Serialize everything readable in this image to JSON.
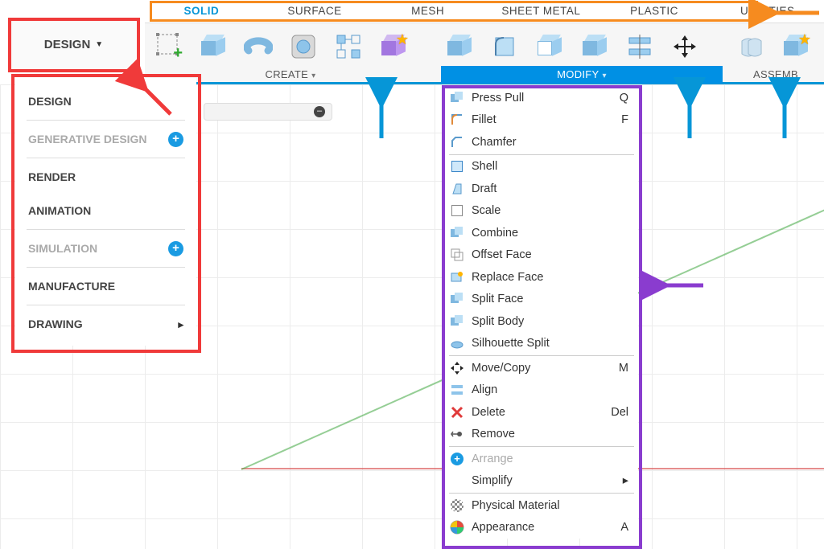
{
  "workspace": {
    "button_label": "DESIGN",
    "items": [
      {
        "label": "DESIGN",
        "muted": false,
        "plus": false,
        "submenu": false
      },
      {
        "label": "GENERATIVE DESIGN",
        "muted": true,
        "plus": true,
        "submenu": false
      },
      {
        "label": "RENDER",
        "muted": false,
        "plus": false,
        "submenu": false
      },
      {
        "label": "ANIMATION",
        "muted": false,
        "plus": false,
        "submenu": false
      },
      {
        "label": "SIMULATION",
        "muted": true,
        "plus": true,
        "submenu": false
      },
      {
        "label": "MANUFACTURE",
        "muted": false,
        "plus": false,
        "submenu": false
      },
      {
        "label": "DRAWING",
        "muted": false,
        "plus": false,
        "submenu": true
      }
    ]
  },
  "tabs": {
    "solid": "SOLID",
    "surface": "SURFACE",
    "mesh": "MESH",
    "sheet_metal": "SHEET METAL",
    "plastic": "PLASTIC",
    "utilities": "UTILITIES"
  },
  "ribbon": {
    "create_label": "CREATE",
    "modify_label": "MODIFY",
    "assemble_label": "ASSEMB"
  },
  "modify_menu": [
    {
      "label": "Press Pull",
      "shortcut": "Q",
      "icon": "press-pull"
    },
    {
      "label": "Fillet",
      "shortcut": "F",
      "icon": "fillet"
    },
    {
      "label": "Chamfer",
      "shortcut": "",
      "icon": "chamfer"
    },
    {
      "sep": true
    },
    {
      "label": "Shell",
      "shortcut": "",
      "icon": "shell"
    },
    {
      "label": "Draft",
      "shortcut": "",
      "icon": "draft"
    },
    {
      "label": "Scale",
      "shortcut": "",
      "icon": "scale"
    },
    {
      "label": "Combine",
      "shortcut": "",
      "icon": "combine"
    },
    {
      "label": "Offset Face",
      "shortcut": "",
      "icon": "offset-face"
    },
    {
      "label": "Replace Face",
      "shortcut": "",
      "icon": "replace-face"
    },
    {
      "label": "Split Face",
      "shortcut": "",
      "icon": "split-face"
    },
    {
      "label": "Split Body",
      "shortcut": "",
      "icon": "split-body"
    },
    {
      "label": "Silhouette Split",
      "shortcut": "",
      "icon": "silhouette"
    },
    {
      "sep": true
    },
    {
      "label": "Move/Copy",
      "shortcut": "M",
      "icon": "move"
    },
    {
      "label": "Align",
      "shortcut": "",
      "icon": "align"
    },
    {
      "label": "Delete",
      "shortcut": "Del",
      "icon": "delete"
    },
    {
      "label": "Remove",
      "shortcut": "",
      "icon": "remove"
    },
    {
      "sep": true
    },
    {
      "label": "Arrange",
      "shortcut": "",
      "icon": "arrange",
      "muted": true
    },
    {
      "label": "Simplify",
      "shortcut": "",
      "icon": "",
      "submenu": true
    },
    {
      "sep": true
    },
    {
      "label": "Physical Material",
      "shortcut": "",
      "icon": "material"
    },
    {
      "label": "Appearance",
      "shortcut": "A",
      "icon": "appearance"
    }
  ],
  "annotations": {
    "orange_arrow": "tabs-outline-arrow",
    "red_arrow": "workspace-arrow",
    "purple_arrow": "modify-menu-arrow",
    "blue_arrows": "ribbon-groups-arrows"
  },
  "colors": {
    "accent_blue": "#0696D7",
    "outline_red": "#F03A3A",
    "outline_orange": "#F68B1F",
    "outline_purple": "#8A3CCF"
  }
}
